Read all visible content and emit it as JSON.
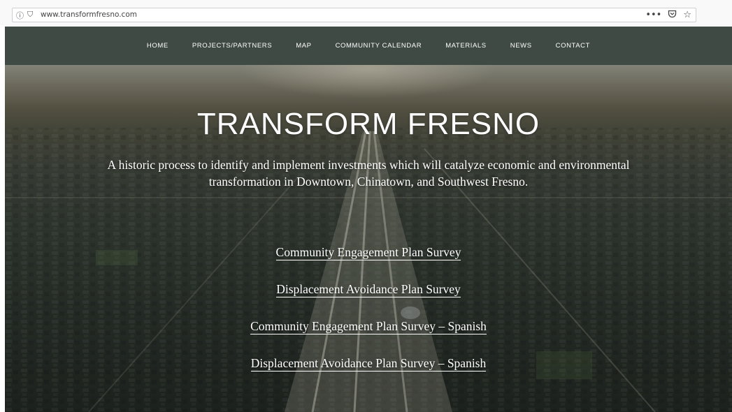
{
  "browser": {
    "url": "www.transformfresno.com",
    "info_icon": "info-icon",
    "shield_icon": "shield-icon",
    "menu_glyph": "•••",
    "pocket_icon": "pocket-icon",
    "bookmark_icon": "star-icon"
  },
  "nav": {
    "items": [
      {
        "label": "HOME"
      },
      {
        "label": "PROJECTS/PARTNERS"
      },
      {
        "label": "MAP"
      },
      {
        "label": "COMMUNITY CALENDAR"
      },
      {
        "label": "MATERIALS"
      },
      {
        "label": "NEWS"
      },
      {
        "label": "CONTACT"
      }
    ],
    "background": "#3f4a45"
  },
  "hero": {
    "title": "TRANSFORM FRESNO",
    "subtitle": "A historic process to identify and implement investments which will catalyze economic and environmental transformation in Downtown, Chinatown, and Southwest Fresno.",
    "links": [
      {
        "label": "Community Engagement Plan Survey"
      },
      {
        "label": "Displacement Avoidance Plan Survey"
      },
      {
        "label": "Community Engagement Plan Survey – Spanish"
      },
      {
        "label": "Displacement Avoidance Plan Survey – Spanish"
      }
    ]
  }
}
